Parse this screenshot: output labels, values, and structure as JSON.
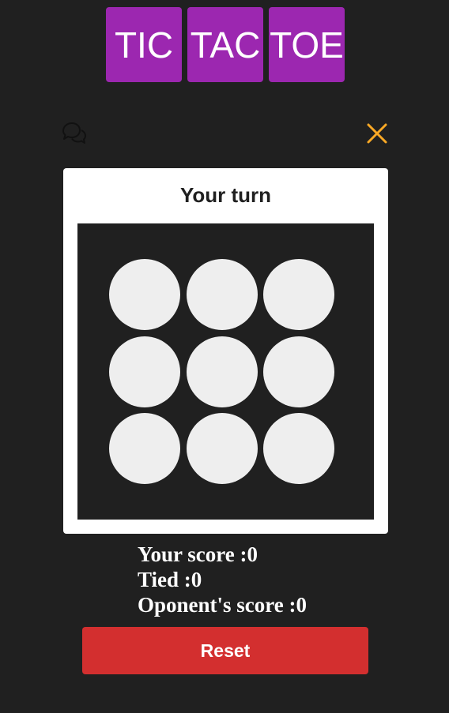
{
  "header": {
    "tiles": [
      "TIC",
      "TAC",
      "TOE"
    ]
  },
  "icons": {
    "chat": "chat-bubbles-icon",
    "close": "close-icon"
  },
  "game": {
    "turn_label": "Your turn",
    "cells": [
      "",
      "",
      "",
      "",
      "",
      "",
      "",
      "",
      ""
    ]
  },
  "scores": {
    "your_score": "Your score :0",
    "tied": "Tied :0",
    "opponent_score": "Oponent's score :0"
  },
  "actions": {
    "reset_label": "Reset"
  },
  "colors": {
    "background": "#202020",
    "tile": "#9c27b0",
    "close_icon": "#f9a825",
    "cell": "#eeeeee",
    "reset": "#d32f2f"
  }
}
